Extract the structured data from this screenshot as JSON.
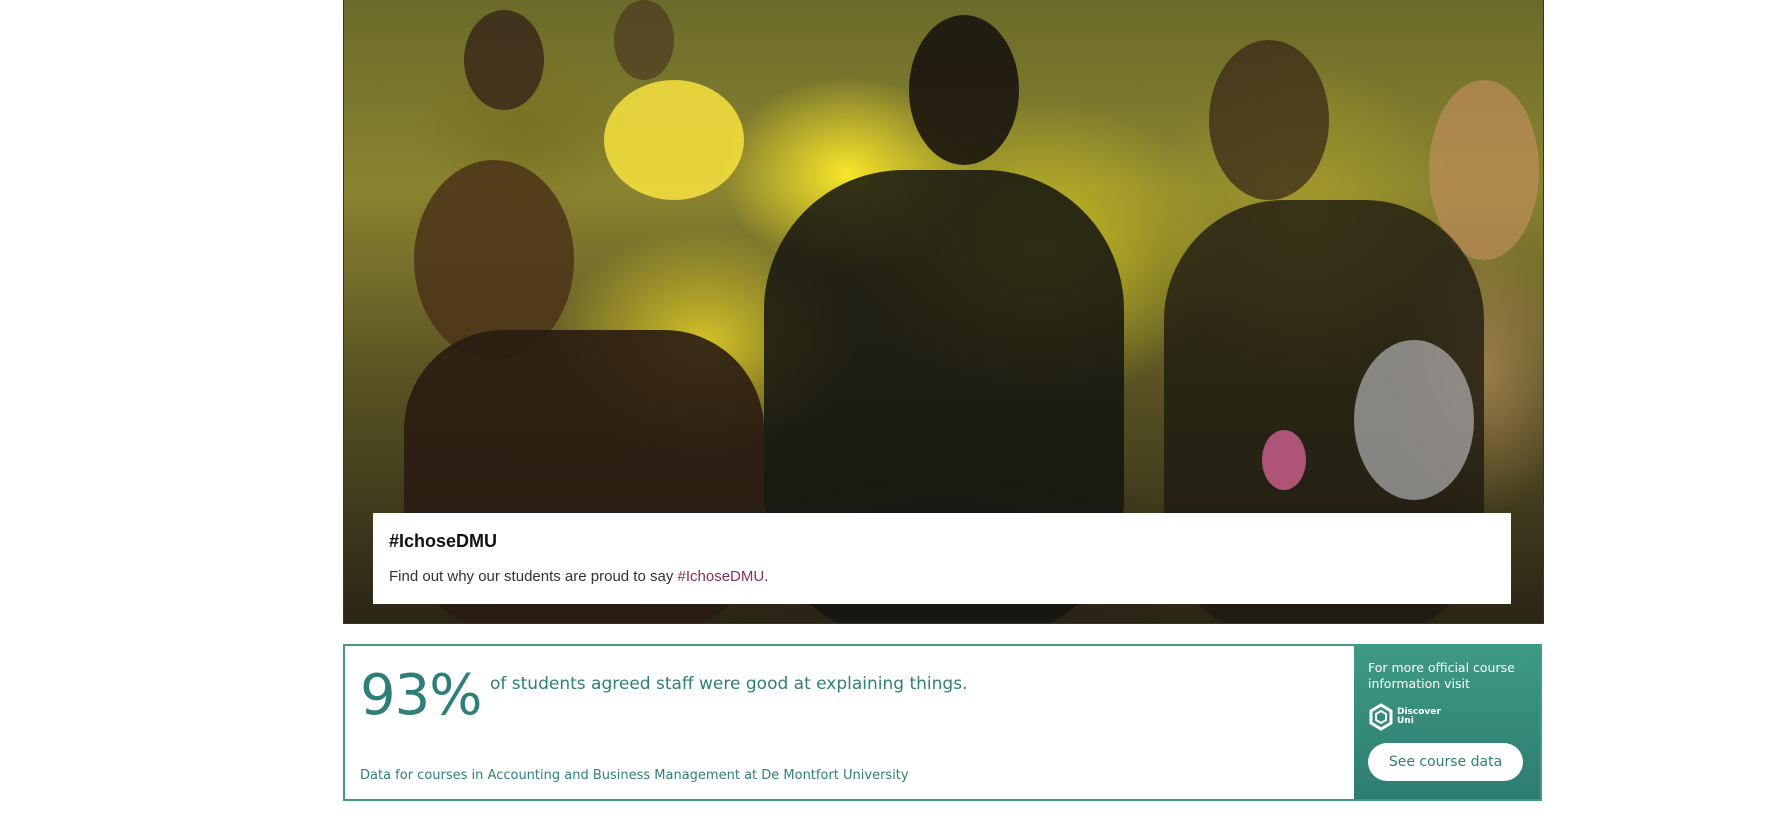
{
  "hero": {
    "image_alt": "Students celebrating with coloured powder",
    "caption": {
      "title": "#IchoseDMU",
      "text_before": "Find out why our students are proud to say ",
      "link": "#IchoseDMU",
      "text_after": "."
    }
  },
  "stats": {
    "value": "93%",
    "description": "of students agreed staff were good at explaining things.",
    "footer": "Data for courses in Accounting and Business Management at De Montfort University",
    "side": {
      "info": "For more official course information visit",
      "logo_line1": "Discover",
      "logo_line2": "Uni",
      "button": "See course data"
    }
  },
  "colors": {
    "accent": "#3f9a83",
    "text_teal": "#2f7f78",
    "link": "#8a2d5a"
  }
}
